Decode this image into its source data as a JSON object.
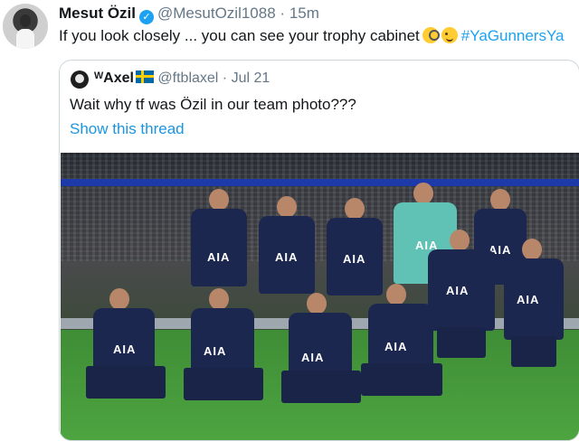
{
  "tweet": {
    "author_name": "Mesut Özil",
    "handle": "@MesutOzil1088",
    "separator": "·",
    "time": "15m",
    "text": "If you look closely ... you can see your trophy cabinet",
    "hashtag": "#YaGunnersYa"
  },
  "quoted_tweet": {
    "author_name": "ᵂAxel",
    "handle": "@ftblaxel",
    "separator": "·",
    "date": "Jul 21",
    "text": "Wait why tf was Özil in our team photo???",
    "link_label": "Show this thread"
  },
  "photo": {
    "shirt_sponsor": "AIA"
  },
  "colors": {
    "link": "#1da1f2",
    "secondary_text": "#657786",
    "border": "#ccd6dd"
  }
}
